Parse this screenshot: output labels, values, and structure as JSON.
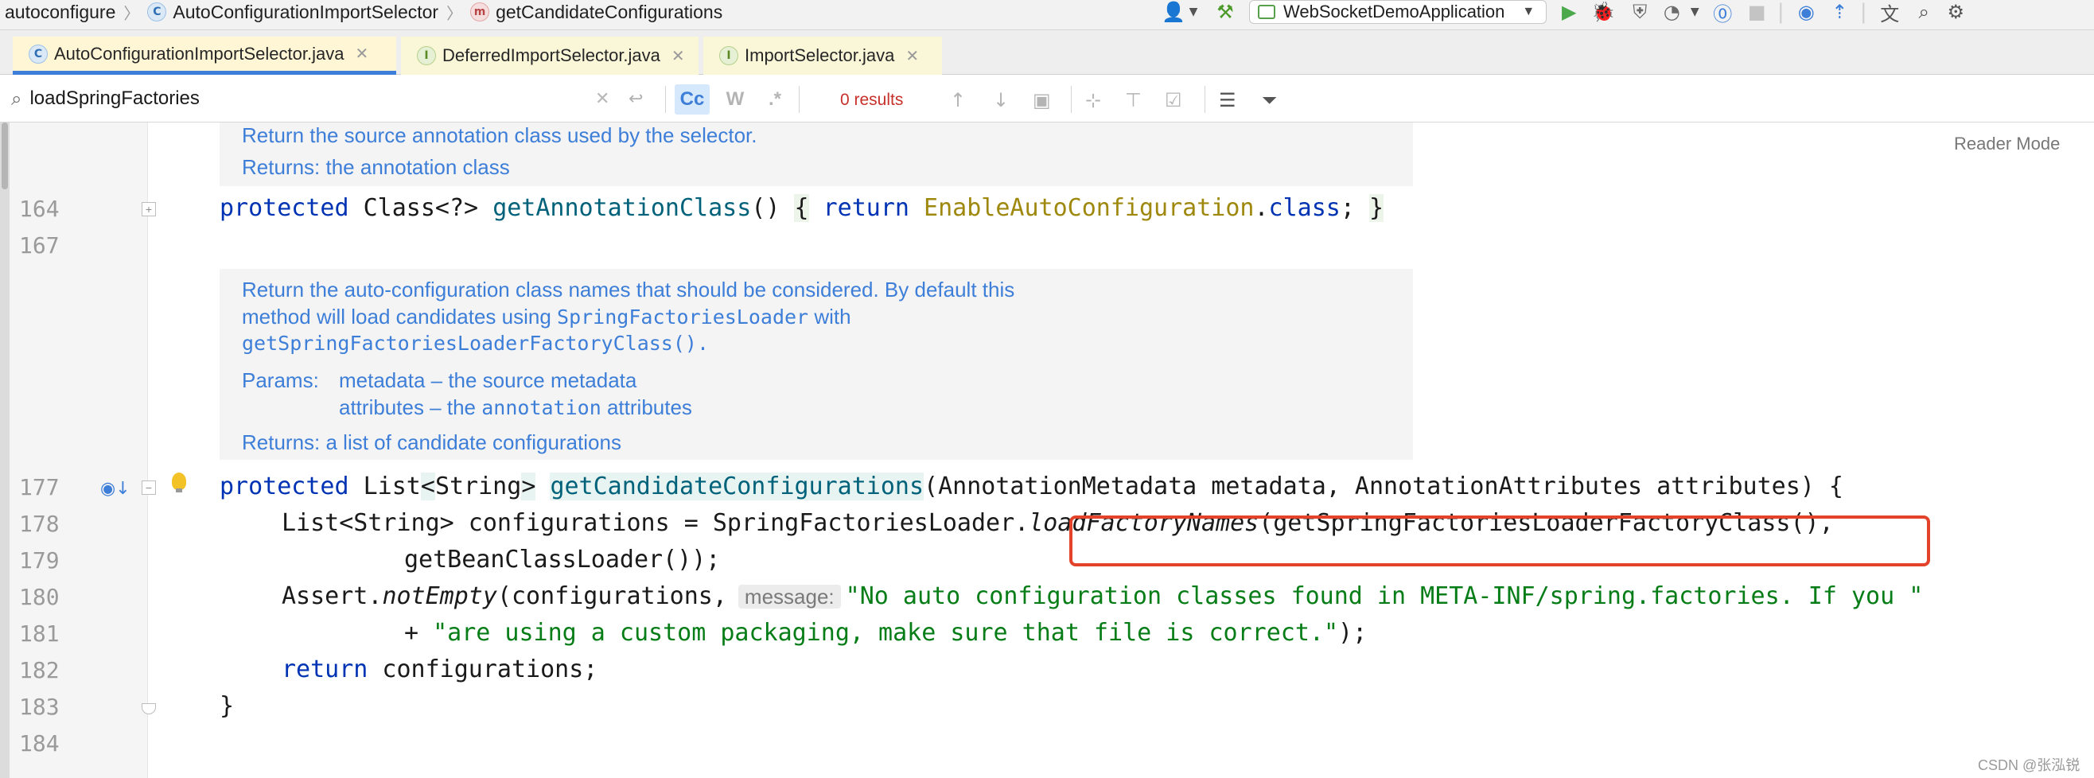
{
  "breadcrumb": [
    {
      "label": "autoconfigure",
      "badge": ""
    },
    {
      "label": "AutoConfigurationImportSelector",
      "badge": "C"
    },
    {
      "label": "getCandidateConfigurations",
      "badge": "m"
    }
  ],
  "run_config": {
    "label": "WebSocketDemoApplication"
  },
  "tabs": [
    {
      "label": "AutoConfigurationImportSelector.java",
      "badge": "C"
    },
    {
      "label": "DeferredImportSelector.java",
      "badge": "I"
    },
    {
      "label": "ImportSelector.java",
      "badge": "I"
    }
  ],
  "search": {
    "value": "loadSpringFactories",
    "match_case_label": "Cc",
    "words_label": "W",
    "regex_label": ".*",
    "results": "0 results"
  },
  "reader_mode": "Reader Mode",
  "docs": {
    "block1": [
      "Return the source annotation class used by the selector.",
      "Returns: the annotation class"
    ],
    "block2": {
      "line1": "Return the auto-configuration class names that should be considered. By default this",
      "line2a": "method will load candidates using ",
      "line2b": "SpringFactoriesLoader",
      "line2c": " with",
      "line3": "getSpringFactoriesLoaderFactoryClass().",
      "params_label": "Params:",
      "param1": "metadata – the source metadata",
      "param2a": "attributes – the ",
      "param2b": "annotation",
      "param2c": " attributes",
      "returns": "Returns: a list of candidate configurations"
    }
  },
  "line_numbers": [
    "164",
    "167",
    "177",
    "178",
    "179",
    "180",
    "181",
    "182",
    "183",
    "184"
  ],
  "code": {
    "l164": {
      "kw": "protected",
      "type": "Class<?>",
      "fn": "getAnnotationClass",
      "paren": "()",
      "ob": "{",
      "ret": "return",
      "ann": "EnableAutoConfiguration",
      "dot": ".",
      "cls": "class",
      "semi": ";",
      "cb": "}"
    },
    "l177": {
      "kw": "protected",
      "type_a": "List",
      "lt": "<",
      "type_b": "String",
      "gt": ">",
      "fn": "getCandidateConfigurations",
      "rest": "(AnnotationMetadata metadata, AnnotationAttributes attributes) {"
    },
    "l178": {
      "a": "List<String> configurations = SpringFactoriesLoader.",
      "fn": "loadFactoryNames",
      "b": "(getSpringFactoriesLoaderFactoryClass(),"
    },
    "l179": {
      "a": "getBeanClassLoader());"
    },
    "l180": {
      "a": "Assert.",
      "fn": "notEmpty",
      "b": "(configurations,",
      "hint": "message:",
      "str": "\"No auto configuration classes found in META-INF/spring.factories. If you \""
    },
    "l181": {
      "plus": "+ ",
      "str": "\"are using a custom packaging, make sure that file is correct.\"",
      "end": ");"
    },
    "l182": {
      "kw": "return",
      "a": " configurations;"
    },
    "l183": {
      "a": "}"
    }
  },
  "watermark": "CSDN @张泓锐",
  "colors": {
    "keyword": "#0033b3",
    "method": "#00627a",
    "string": "#067d17",
    "doc": "#3d7ed8",
    "highlight_box": "#e2432a",
    "results": "#c8302a"
  }
}
